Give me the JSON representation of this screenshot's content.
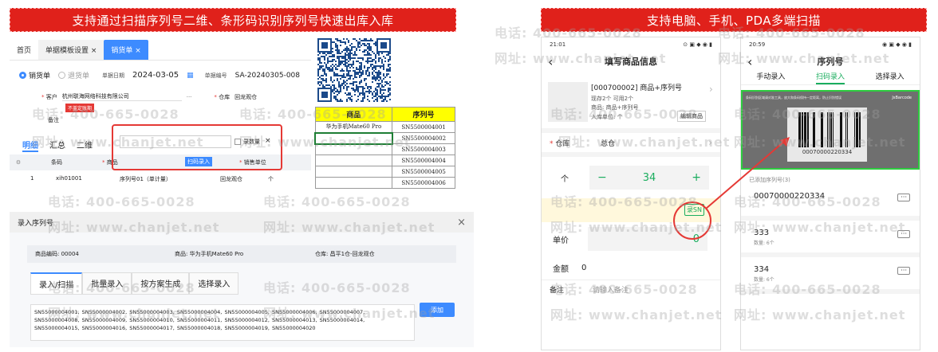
{
  "banners": {
    "left": "支持通过扫描序列号二维、条形码识别序列号快速出库入库",
    "right": "支持电脑、手机、PDA多端扫描"
  },
  "watermark": {
    "phone": "电话: 400-665-0028",
    "site": "网址: www.chanjet.net"
  },
  "erp": {
    "tabs": [
      "首页",
      "单据模板设置 ×",
      "销货单 ×"
    ],
    "radio_sale": "销货单",
    "radio_return": "退货单",
    "date_label": "单据日期",
    "date_value": "2024-03-05",
    "no_label": "单据编号",
    "no_value": "SA-20240305-008",
    "customer_label": "客户",
    "customer_value": "杭州联海网络科技有限公司",
    "customer_dots": "···",
    "credit_badge": "不盖定账期",
    "warehouse_label": "仓库",
    "warehouse_value": "回龙观仓",
    "remark_label": "备注",
    "subtabs": [
      "明细",
      "汇总",
      "二维"
    ],
    "popup_check": "录数量",
    "popup_close": "×",
    "grid_headers": [
      "条码",
      "商品",
      "仓库",
      "销售单位"
    ],
    "scan_badge": "扫码录入",
    "grid_row": {
      "no": "1",
      "code": "xih01001",
      "item": "序列号01（单计量）",
      "wh": "回龙观仓",
      "unit": "个"
    }
  },
  "excel": {
    "headers": [
      "商品",
      "序列号"
    ],
    "rows": [
      [
        "华为手机Mate60 Pro",
        "SN5500004001"
      ],
      [
        "",
        "SN5500004002"
      ],
      [
        "",
        "SN5500004003"
      ],
      [
        "",
        "SN5500004004"
      ],
      [
        "",
        "SN5500004005"
      ],
      [
        "",
        "SN5500004006"
      ]
    ]
  },
  "dialog": {
    "title": "录入序列号",
    "close": "×",
    "code_label": "商品编码: 00004",
    "item_label": "商品: 华为手机Mate60 Pro",
    "wh_label": "仓库: 昌平1仓-回龙观仓",
    "tabs": [
      "录入/扫描",
      "批量录入",
      "按方案生成",
      "选择录入"
    ],
    "add_button": "添加",
    "sn_text": "SN55000004001, SN55000004002, SN55000004003, SN55000004004, SN55000004005, SN55000004006, SN55000004007, SN55000004008, SN55000004009, SN55000004010, SN55000004011, SN55000004012, SN55000004013, SN55000004014, SN55000004015, SN55000004016, SN55000004017, SN55000004018, SN55000004019, SN55000004020"
  },
  "phone1": {
    "time": "21:01",
    "status_icons": "⊙ ▣ ◆ ◉ ▮",
    "title": "填写商品信息",
    "back": "‹",
    "item_name": "[000700002] 商品+序列号",
    "stock": "现存2个  可用2个",
    "item_sub": "商品: 商品+序列号",
    "unit": "入库单位: 个",
    "edit": "编辑商品",
    "chev": "›",
    "wh_label": "仓库",
    "wh_value": "总仓",
    "qty_unit": "个",
    "minus": "−",
    "qty": "34",
    "plus": "+",
    "sn_button": "录SN",
    "price_label": "单价",
    "price_value": "0",
    "amount_label": "金额",
    "amount_value": "0",
    "remark_label": "备注",
    "remark_placeholder": "请输入备注"
  },
  "phone2": {
    "time": "20:59",
    "status_icons": "◉ ▣ ◆ ◉ ▮",
    "title": "序列号",
    "back": "‹",
    "tabs": [
      "手动录入",
      "扫码录入",
      "选择录入"
    ],
    "scan_hint": "条码识别区域请对准工具，放大和条码保持一定距离，防止识别错误",
    "scan_brand": "JsBarcode",
    "barcode_number": "00070000220334",
    "added_label": "已添加序列号(3)",
    "items": [
      {
        "sn": "00070000220334",
        "qty": ""
      },
      {
        "sn": "333",
        "qty": "数量: 6个"
      },
      {
        "sn": "334",
        "qty": "数量: 6个"
      }
    ],
    "more": "···"
  }
}
